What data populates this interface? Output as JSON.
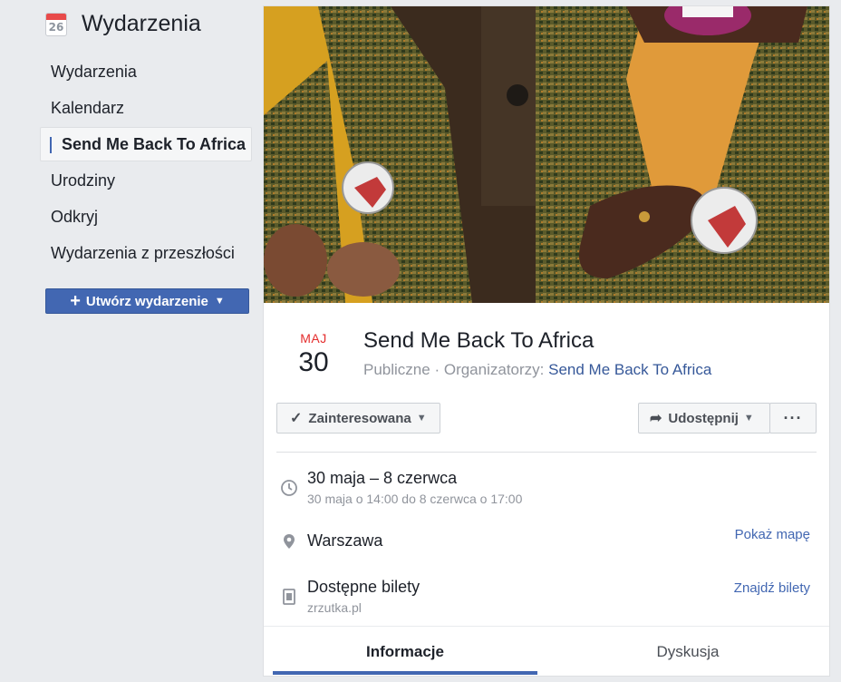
{
  "sidebar": {
    "calendar_day": "26",
    "title": "Wydarzenia",
    "items": [
      {
        "label": "Wydarzenia"
      },
      {
        "label": "Kalendarz"
      },
      {
        "label": "Send Me Back To Africa"
      },
      {
        "label": "Urodziny"
      },
      {
        "label": "Odkryj"
      },
      {
        "label": "Wydarzenia z przeszłości"
      }
    ],
    "create_label": "Utwórz wydarzenie"
  },
  "event": {
    "month": "MAJ",
    "day": "30",
    "title": "Send Me Back To Africa",
    "privacy": "Publiczne",
    "organizers_label": "Organizatorzy:",
    "organizer": "Send Me Back To Africa",
    "interested_label": "Zainteresowana",
    "share_label": "Udostępnij",
    "more_label": "···"
  },
  "details": {
    "date_main": "30 maja – 8 czerwca",
    "date_sub": "30 maja o 14:00 do 8 czerwca o 17:00",
    "location": "Warszawa",
    "show_map": "Pokaż mapę",
    "tickets_main": "Dostępne bilety",
    "tickets_sub": "zrzutka.pl",
    "find_tickets": "Znajdź bilety"
  },
  "tabs": [
    {
      "label": "Informacje",
      "active": true
    },
    {
      "label": "Dyskusja",
      "active": false
    }
  ],
  "colors": {
    "accent": "#4267b2",
    "month_red": "#e42d2d",
    "background": "#e9ebee"
  }
}
